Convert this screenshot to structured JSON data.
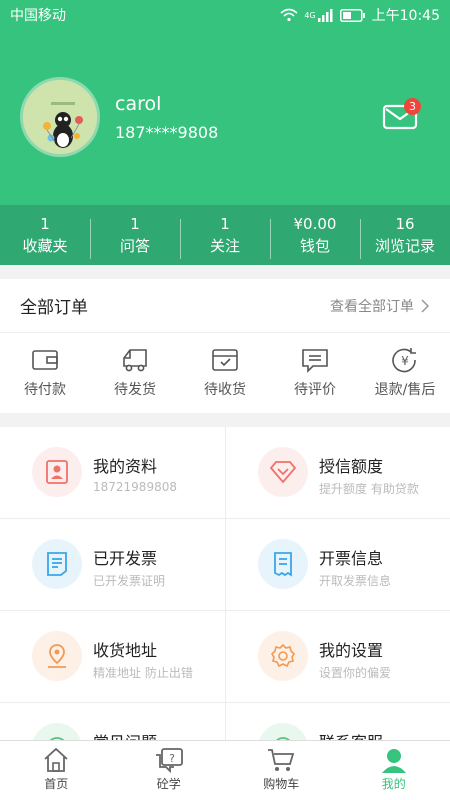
{
  "status_bar": {
    "carrier": "中国移动",
    "network": "4G",
    "time": "上午10:45"
  },
  "profile": {
    "username": "carol",
    "phone": "187****9808",
    "unread_count": "3"
  },
  "stats": [
    {
      "value": "1",
      "label": "收藏夹"
    },
    {
      "value": "1",
      "label": "问答"
    },
    {
      "value": "1",
      "label": "关注"
    },
    {
      "value": "¥0.00",
      "label": "钱包"
    },
    {
      "value": "16",
      "label": "浏览记录"
    }
  ],
  "orders": {
    "title": "全部订单",
    "view_all": "查看全部订单",
    "items": [
      {
        "label": "待付款",
        "icon": "wallet-icon"
      },
      {
        "label": "待发货",
        "icon": "truck-icon"
      },
      {
        "label": "待收货",
        "icon": "box-icon"
      },
      {
        "label": "待评价",
        "icon": "comment-icon"
      },
      {
        "label": "退款/售后",
        "icon": "refund-icon"
      }
    ]
  },
  "menu": [
    {
      "title": "我的资料",
      "subtitle": "18721989808",
      "icon": "profile-card-icon",
      "color": "#f0706a",
      "bg": "#fdeeee"
    },
    {
      "title": "授信额度",
      "subtitle": "提升额度  有助贷款",
      "icon": "diamond-icon",
      "color": "#f0706a",
      "bg": "#fdeeee"
    },
    {
      "title": "已开发票",
      "subtitle": "已开发票证明",
      "icon": "invoice-icon",
      "color": "#3aa6e6",
      "bg": "#e8f4fc"
    },
    {
      "title": "开票信息",
      "subtitle": "开取发票信息",
      "icon": "receipt-icon",
      "color": "#3aa6e6",
      "bg": "#e8f4fc"
    },
    {
      "title": "收货地址",
      "subtitle": "精准地址  防止出错",
      "icon": "location-icon",
      "color": "#f29a52",
      "bg": "#fdf0e6"
    },
    {
      "title": "我的设置",
      "subtitle": "设置你的偏爱",
      "icon": "settings-icon",
      "color": "#f29a52",
      "bg": "#fdf0e6"
    },
    {
      "title": "常见问题",
      "subtitle": "",
      "icon": "question-icon",
      "color": "#5cc27b",
      "bg": "#e9f8ee"
    },
    {
      "title": "联系客服",
      "subtitle": "",
      "icon": "headset-icon",
      "color": "#5cc27b",
      "bg": "#e9f8ee"
    }
  ],
  "tabbar": [
    {
      "label": "首页",
      "icon": "home-icon"
    },
    {
      "label": "砼学",
      "icon": "qa-icon"
    },
    {
      "label": "购物车",
      "icon": "cart-icon"
    },
    {
      "label": "我的",
      "icon": "user-icon"
    }
  ],
  "colors": {
    "brand": "#36c37e",
    "stats_bg": "#2fa872",
    "badge": "#f0453a"
  }
}
